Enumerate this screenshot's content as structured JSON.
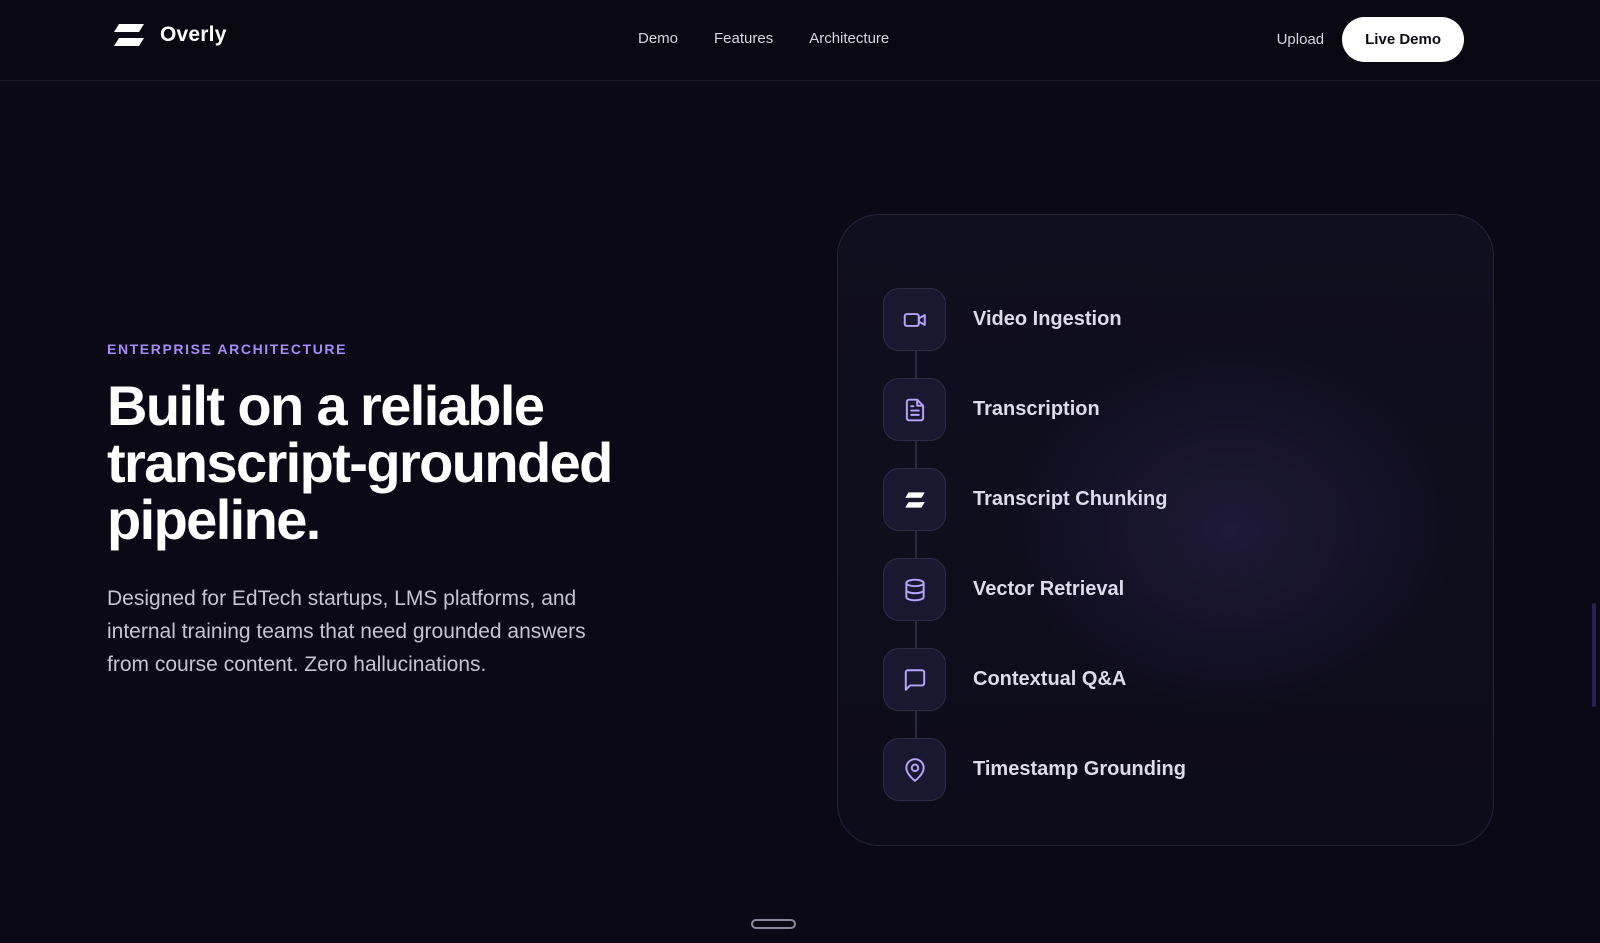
{
  "nav": {
    "brand_name": "Overly",
    "links": [
      "Demo",
      "Features",
      "Architecture"
    ],
    "upload_label": "Upload",
    "live_demo_label": "Live Demo"
  },
  "hero": {
    "eyebrow": "ENTERPRISE ARCHITECTURE",
    "headline_lines": [
      "Built on a reliable",
      "transcript-grounded",
      "pipeline."
    ],
    "description": "Designed for EdTech startups, LMS platforms, and internal training teams that need grounded answers from course content. Zero hallucinations."
  },
  "pipeline": {
    "steps": [
      {
        "label": "Video Ingestion",
        "icon": "video-camera-icon"
      },
      {
        "label": "Transcription",
        "icon": "document-icon"
      },
      {
        "label": "Transcript Chunking",
        "icon": "logo-mark-icon"
      },
      {
        "label": "Vector Retrieval",
        "icon": "database-icon"
      },
      {
        "label": "Contextual Q&A",
        "icon": "message-square-icon"
      },
      {
        "label": "Timestamp Grounding",
        "icon": "map-pin-icon"
      }
    ]
  },
  "colors": {
    "background": "#0a0915",
    "accent": "#a78bfa",
    "button_bg": "#ffffff"
  }
}
